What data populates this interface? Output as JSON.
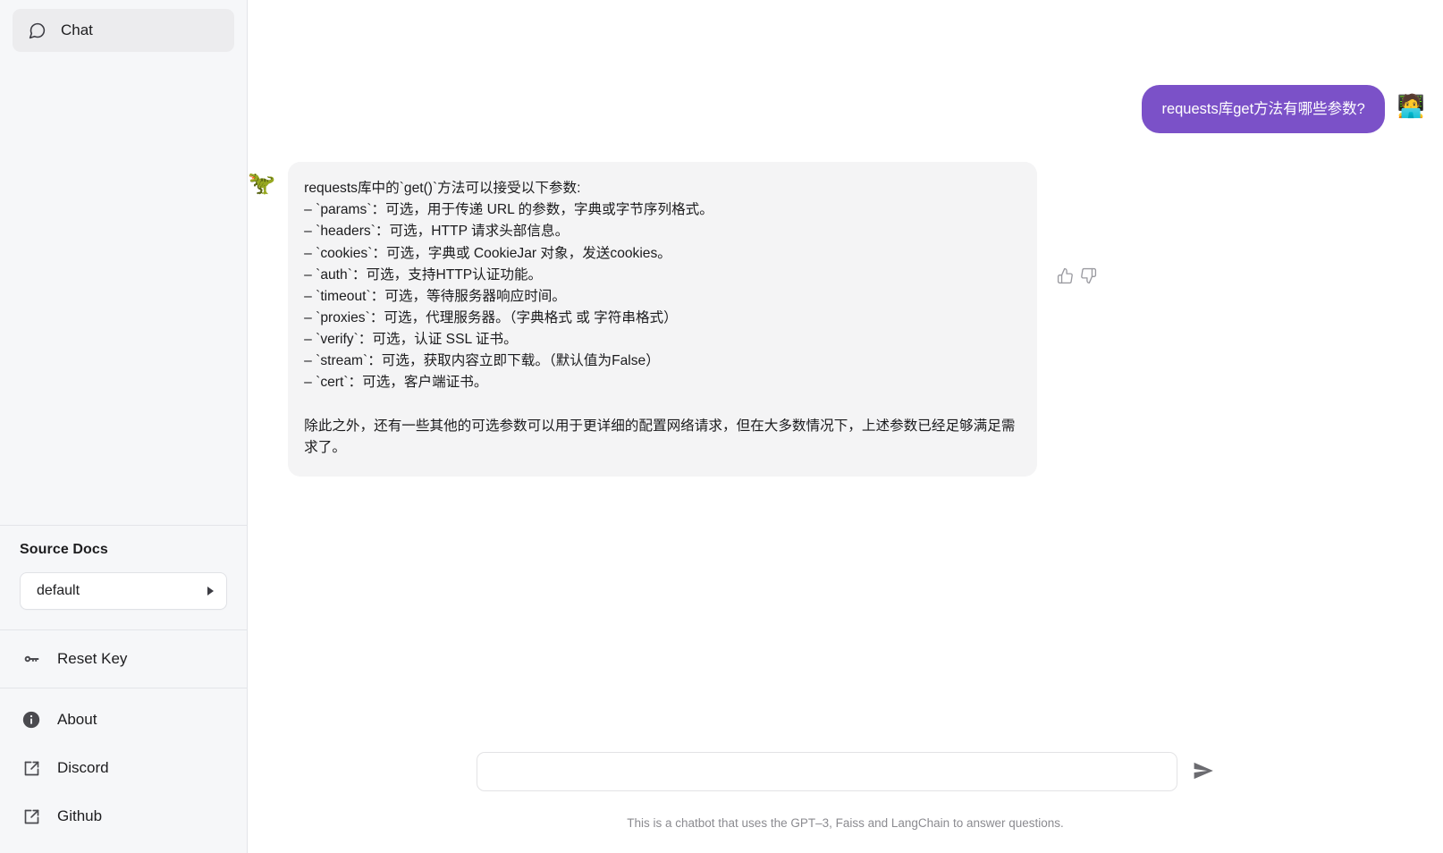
{
  "sidebar": {
    "nav": [
      {
        "label": "Chat",
        "icon": "chat-bubble-icon",
        "active": true
      }
    ],
    "source_docs": {
      "title": "Source Docs",
      "selected": "default",
      "options": [
        "default"
      ],
      "arrow_icon": "caret-right-icon"
    },
    "reset": {
      "label": "Reset Key",
      "icon": "key-icon"
    },
    "links": [
      {
        "label": "About",
        "icon": "info-circle-icon"
      },
      {
        "label": "Discord",
        "icon": "external-link-icon"
      },
      {
        "label": "Github",
        "icon": "external-link-icon"
      }
    ]
  },
  "chat": {
    "user_message": {
      "text": "requests库get方法有哪些参数?",
      "avatar": "🧑‍💻",
      "bubble_color": "#7b51c8"
    },
    "bot_message": {
      "avatar": "🦖",
      "bubble_color": "#f4f4f5",
      "text": "requests库中的`get()`方法可以接受以下参数:\n– `params`：可选，用于传递 URL 的参数，字典或字节序列格式。\n– `headers`：可选，HTTP 请求头部信息。\n– `cookies`：可选，字典或 CookieJar 对象，发送cookies。\n– `auth`：可选，支持HTTP认证功能。\n– `timeout`：可选，等待服务器响应时间。\n– `proxies`：可选，代理服务器。（字典格式 或 字符串格式）\n– `verify`：可选，认证 SSL 证书。\n– `stream`：可选，获取内容立即下载。（默认值为False）\n– `cert`：可选，客户端证书。\n\n除此之外，还有一些其他的可选参数可以用于更详细的配置网络请求，但在大多数情况下，上述参数已经足够满足需求了。"
    },
    "feedback": {
      "thumbs_up": "thumbs-up-icon",
      "thumbs_down": "thumbs-down-icon"
    }
  },
  "composer": {
    "input_value": "",
    "placeholder": "",
    "send_icon": "send-arrow-icon"
  },
  "footer": {
    "note": "This is a chatbot that uses the GPT–3, Faiss and LangChain to answer questions."
  }
}
